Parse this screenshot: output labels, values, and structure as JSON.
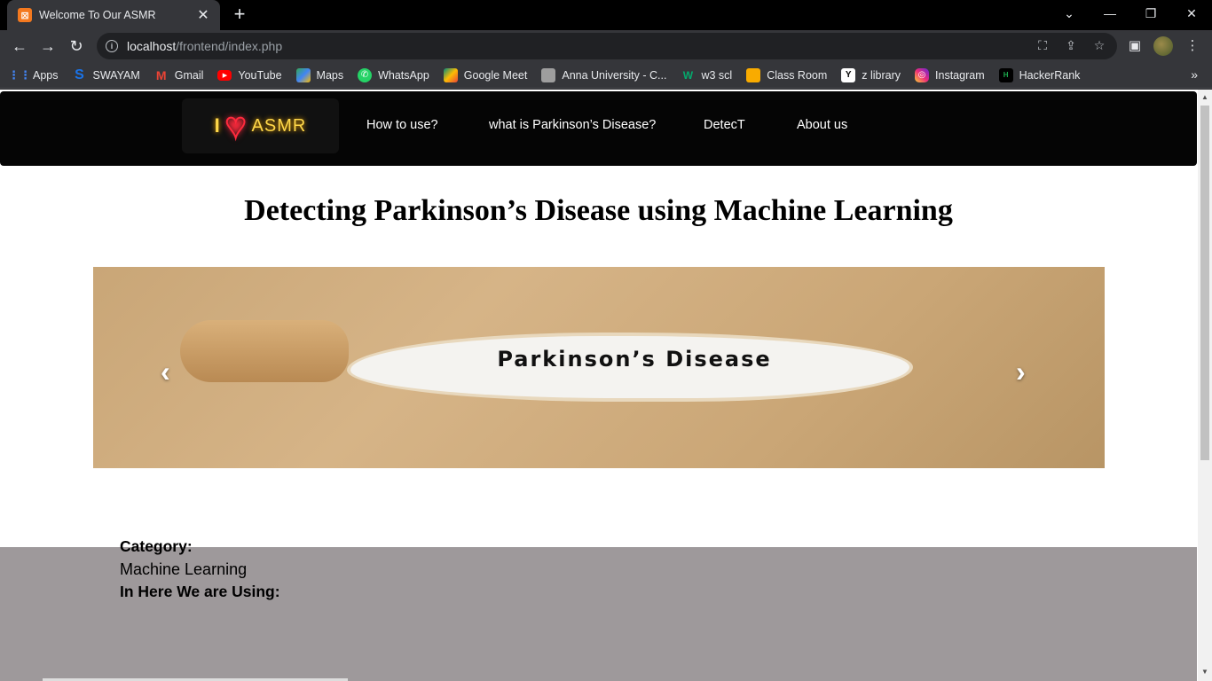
{
  "browser": {
    "tab_title": "Welcome To Our ASMR",
    "url_host": "localhost",
    "url_path": "/frontend/index.php"
  },
  "bookmarks": [
    {
      "label": "Apps",
      "icon": "apps-grid-icon",
      "color": "#4285f4"
    },
    {
      "label": "SWAYAM",
      "icon": "swayam-icon",
      "color": "#1a73e8"
    },
    {
      "label": "Gmail",
      "icon": "gmail-icon",
      "color": "#ea4335"
    },
    {
      "label": "YouTube",
      "icon": "youtube-icon",
      "color": "#ff0000"
    },
    {
      "label": "Maps",
      "icon": "maps-icon",
      "color": "#34a853"
    },
    {
      "label": "WhatsApp",
      "icon": "whatsapp-icon",
      "color": "#25d366"
    },
    {
      "label": "Google Meet",
      "icon": "google-meet-icon",
      "color": "#00897b"
    },
    {
      "label": "Anna University - C...",
      "icon": "anna-university-icon",
      "color": "#9e9e9e"
    },
    {
      "label": "w3 scl",
      "icon": "w3schools-icon",
      "color": "#04aa6d"
    },
    {
      "label": "Class Room",
      "icon": "classroom-icon",
      "color": "#f9ab00"
    },
    {
      "label": "z library",
      "icon": "zlibrary-icon",
      "color": "#ffffff"
    },
    {
      "label": "Instagram",
      "icon": "instagram-icon",
      "color": "#e1306c"
    },
    {
      "label": "HackerRank",
      "icon": "hackerrank-icon",
      "color": "#1ba94c"
    }
  ],
  "site": {
    "logo_i": "I",
    "logo_text": "ASMR",
    "nav": {
      "how_to_use": "How to use?",
      "what_is": "what is Parkinson’s Disease?",
      "detect": "DetecT",
      "about": "About us"
    },
    "title": "Detecting Parkinson’s Disease using Machine Learning",
    "carousel_caption": "Parkinson’s Disease",
    "category_label": "Category:",
    "category_value": "Machine Learning",
    "cut_label": "In Here We are Using:"
  }
}
